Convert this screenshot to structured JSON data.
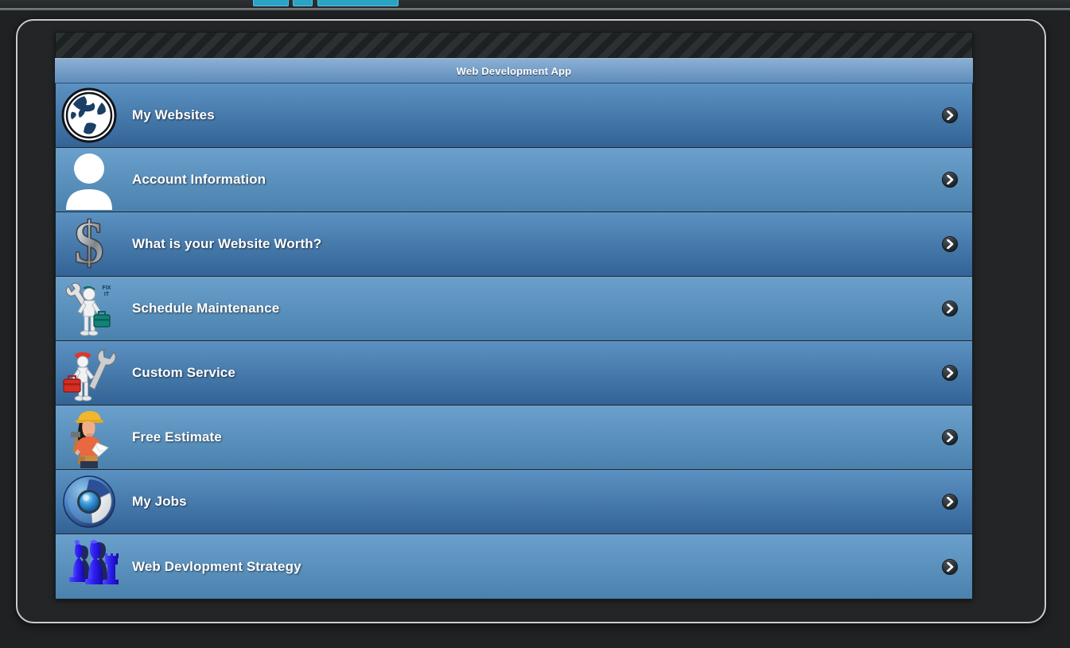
{
  "window": {
    "striped_toolbar": "striped-toolbar",
    "frame": "device-frame"
  },
  "top_bar": {
    "chips": [
      "teal-chip-1",
      "teal-chip-2",
      "teal-chip-3"
    ]
  },
  "header": {
    "title": "Web Development App"
  },
  "list": {
    "items": [
      {
        "label": "My Websites",
        "icon": "globe-icon",
        "shade": "dark"
      },
      {
        "label": "Account Information",
        "icon": "person-icon",
        "shade": "light"
      },
      {
        "label": "What is your Website Worth?",
        "icon": "dollar-sign-icon",
        "shade": "dark"
      },
      {
        "label": "Schedule Maintenance",
        "icon": "repairman-fixit-icon",
        "shade": "light"
      },
      {
        "label": "Custom Service",
        "icon": "wrench-toolbox-icon",
        "shade": "dark"
      },
      {
        "label": "Free Estimate",
        "icon": "contractor-woman-icon",
        "shade": "light"
      },
      {
        "label": "My Jobs",
        "icon": "chromium-orb-icon",
        "shade": "dark"
      },
      {
        "label": "Web Devlopment Strategy",
        "icon": "chess-pieces-icon",
        "shade": "light"
      }
    ],
    "disclosure_icon": "chevron-right-icon"
  },
  "colors": {
    "row_dark_top": "#5b92c2",
    "row_dark_bottom": "#336396",
    "row_light_top": "#6ba0cc",
    "row_light_bottom": "#4a81ad",
    "header_top": "#8cb0d4",
    "header_bottom": "#5e8cbb",
    "frame_border": "#c9cbcc",
    "background": "#1f2122",
    "accent_teal": "#2ba3c4",
    "text": "#ffffff"
  }
}
